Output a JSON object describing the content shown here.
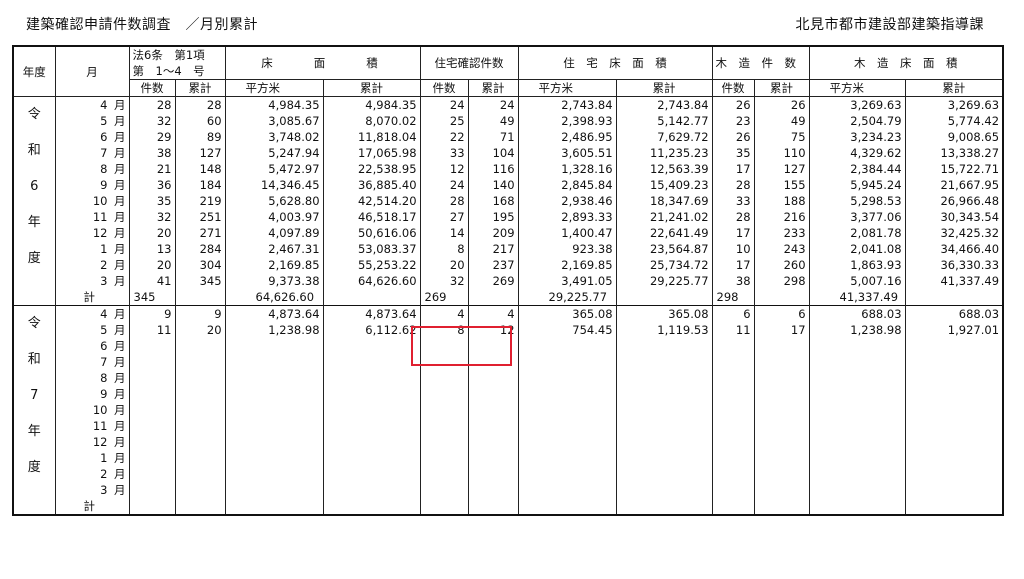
{
  "header": {
    "title_left": "建築確認申請件数調査　／月別累計",
    "title_right": "北見市都市建設部建築指導課"
  },
  "columns": {
    "year": "年度",
    "month": "月",
    "law6_line1": "法6条　第1項",
    "law6_line2": "第　1～4　号",
    "floor_area": "床　　面　　積",
    "housing_count": "住宅確認件数",
    "housing_floor_area": "住　宅　床　面　積",
    "wooden_count": "木　造　件　数",
    "wooden_floor_area": "木　造　床　面　積",
    "count": "件数",
    "cumulative": "累計",
    "sqm": "平方米"
  },
  "r6": {
    "era_chars": [
      "令",
      "和",
      "6",
      "年",
      "度"
    ],
    "rows": [
      {
        "mnum": "4",
        "unit": "月",
        "c1": "28",
        "c2": "28",
        "c3": "4,984.35",
        "c4": "4,984.35",
        "c5": "24",
        "c6": "24",
        "c7": "2,743.84",
        "c8": "2,743.84",
        "c9": "26",
        "c10": "26",
        "c11": "3,269.63",
        "c12": "3,269.63"
      },
      {
        "mnum": "5",
        "unit": "月",
        "c1": "32",
        "c2": "60",
        "c3": "3,085.67",
        "c4": "8,070.02",
        "c5": "25",
        "c6": "49",
        "c7": "2,398.93",
        "c8": "5,142.77",
        "c9": "23",
        "c10": "49",
        "c11": "2,504.79",
        "c12": "5,774.42"
      },
      {
        "mnum": "6",
        "unit": "月",
        "c1": "29",
        "c2": "89",
        "c3": "3,748.02",
        "c4": "11,818.04",
        "c5": "22",
        "c6": "71",
        "c7": "2,486.95",
        "c8": "7,629.72",
        "c9": "26",
        "c10": "75",
        "c11": "3,234.23",
        "c12": "9,008.65"
      },
      {
        "mnum": "7",
        "unit": "月",
        "c1": "38",
        "c2": "127",
        "c3": "5,247.94",
        "c4": "17,065.98",
        "c5": "33",
        "c6": "104",
        "c7": "3,605.51",
        "c8": "11,235.23",
        "c9": "35",
        "c10": "110",
        "c11": "4,329.62",
        "c12": "13,338.27"
      },
      {
        "mnum": "8",
        "unit": "月",
        "c1": "21",
        "c2": "148",
        "c3": "5,472.97",
        "c4": "22,538.95",
        "c5": "12",
        "c6": "116",
        "c7": "1,328.16",
        "c8": "12,563.39",
        "c9": "17",
        "c10": "127",
        "c11": "2,384.44",
        "c12": "15,722.71"
      },
      {
        "mnum": "9",
        "unit": "月",
        "c1": "36",
        "c2": "184",
        "c3": "14,346.45",
        "c4": "36,885.40",
        "c5": "24",
        "c6": "140",
        "c7": "2,845.84",
        "c8": "15,409.23",
        "c9": "28",
        "c10": "155",
        "c11": "5,945.24",
        "c12": "21,667.95"
      },
      {
        "mnum": "10",
        "unit": "月",
        "c1": "35",
        "c2": "219",
        "c3": "5,628.80",
        "c4": "42,514.20",
        "c5": "28",
        "c6": "168",
        "c7": "2,938.46",
        "c8": "18,347.69",
        "c9": "33",
        "c10": "188",
        "c11": "5,298.53",
        "c12": "26,966.48"
      },
      {
        "mnum": "11",
        "unit": "月",
        "c1": "32",
        "c2": "251",
        "c3": "4,003.97",
        "c4": "46,518.17",
        "c5": "27",
        "c6": "195",
        "c7": "2,893.33",
        "c8": "21,241.02",
        "c9": "28",
        "c10": "216",
        "c11": "3,377.06",
        "c12": "30,343.54"
      },
      {
        "mnum": "12",
        "unit": "月",
        "c1": "20",
        "c2": "271",
        "c3": "4,097.89",
        "c4": "50,616.06",
        "c5": "14",
        "c6": "209",
        "c7": "1,400.47",
        "c8": "22,641.49",
        "c9": "17",
        "c10": "233",
        "c11": "2,081.78",
        "c12": "32,425.32"
      },
      {
        "mnum": "1",
        "unit": "月",
        "c1": "13",
        "c2": "284",
        "c3": "2,467.31",
        "c4": "53,083.37",
        "c5": "8",
        "c6": "217",
        "c7": "923.38",
        "c8": "23,564.87",
        "c9": "10",
        "c10": "243",
        "c11": "2,041.08",
        "c12": "34,466.40"
      },
      {
        "mnum": "2",
        "unit": "月",
        "c1": "20",
        "c2": "304",
        "c3": "2,169.85",
        "c4": "55,253.22",
        "c5": "20",
        "c6": "237",
        "c7": "2,169.85",
        "c8": "25,734.72",
        "c9": "17",
        "c10": "260",
        "c11": "1,863.93",
        "c12": "36,330.33"
      },
      {
        "mnum": "3",
        "unit": "月",
        "c1": "41",
        "c2": "345",
        "c3": "9,373.38",
        "c4": "64,626.60",
        "c5": "32",
        "c6": "269",
        "c7": "3,491.05",
        "c8": "29,225.77",
        "c9": "38",
        "c10": "298",
        "c11": "5,007.16",
        "c12": "41,337.49"
      }
    ],
    "total": {
      "label": "計",
      "c1": "345",
      "c3": "64,626.60",
      "c5": "269",
      "c7": "29,225.77",
      "c9": "298",
      "c11": "41,337.49"
    }
  },
  "r7": {
    "era_chars": [
      "令",
      "和",
      "7",
      "年",
      "度"
    ],
    "rows": [
      {
        "mnum": "4",
        "unit": "月",
        "c1": "9",
        "c2": "9",
        "c3": "4,873.64",
        "c4": "4,873.64",
        "c5": "4",
        "c6": "4",
        "c7": "365.08",
        "c8": "365.08",
        "c9": "6",
        "c10": "6",
        "c11": "688.03",
        "c12": "688.03"
      },
      {
        "mnum": "5",
        "unit": "月",
        "c1": "11",
        "c2": "20",
        "c3": "1,238.98",
        "c4": "6,112.62",
        "c5": "8",
        "c6": "12",
        "c7": "754.45",
        "c8": "1,119.53",
        "c9": "11",
        "c10": "17",
        "c11": "1,238.98",
        "c12": "1,927.01"
      },
      {
        "mnum": "6",
        "unit": "月"
      },
      {
        "mnum": "7",
        "unit": "月"
      },
      {
        "mnum": "8",
        "unit": "月"
      },
      {
        "mnum": "9",
        "unit": "月"
      },
      {
        "mnum": "10",
        "unit": "月"
      },
      {
        "mnum": "11",
        "unit": "月"
      },
      {
        "mnum": "12",
        "unit": "月"
      },
      {
        "mnum": "1",
        "unit": "月"
      },
      {
        "mnum": "2",
        "unit": "月"
      },
      {
        "mnum": "3",
        "unit": "月"
      }
    ],
    "total": {
      "label": "計"
    }
  },
  "highlight_color": "#e02030"
}
